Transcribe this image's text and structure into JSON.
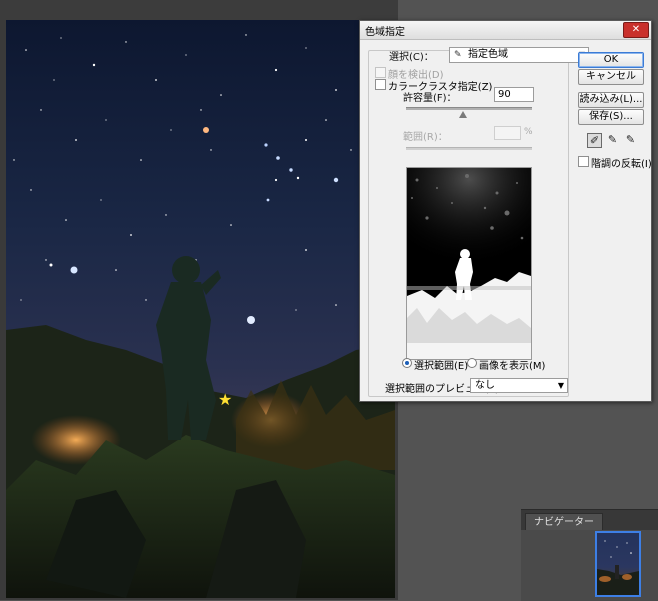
{
  "dialog": {
    "title": "色域指定",
    "close_glyph": "✕",
    "selection_label": "選択(C)：",
    "selection_value": "指定色域",
    "selection_icon": "eyedropper-icon",
    "detect_faces_label": "顔を検出(D)",
    "localized_clusters_label": "カラークラスタ指定(Z)",
    "fuzziness_label": "許容量(F)：",
    "fuzziness_value": "90",
    "fuzziness_level": 0.45,
    "range_label": "範囲(R)：",
    "range_value": "",
    "range_unit": "%",
    "radio_selection_label": "選択範囲(E)",
    "radio_image_label": "画像を表示(M)",
    "selected_radio": "selection",
    "selection_preview_label": "選択範囲のプレビュー(T)：",
    "selection_preview_value": "なし",
    "invert_label": "階調の反転(I)",
    "buttons": {
      "ok": "OK",
      "cancel": "キャンセル",
      "load": "読み込み(L)...",
      "save": "保存(S)..."
    },
    "droppers": [
      "eyedropper-icon",
      "eyedropper-plus-icon",
      "eyedropper-minus-icon"
    ]
  },
  "navigator": {
    "tab_label": "ナビゲーター"
  },
  "colors": {
    "accent": "#3d7fe5",
    "close": "#c9302c",
    "star_marker": "#ffe033"
  }
}
